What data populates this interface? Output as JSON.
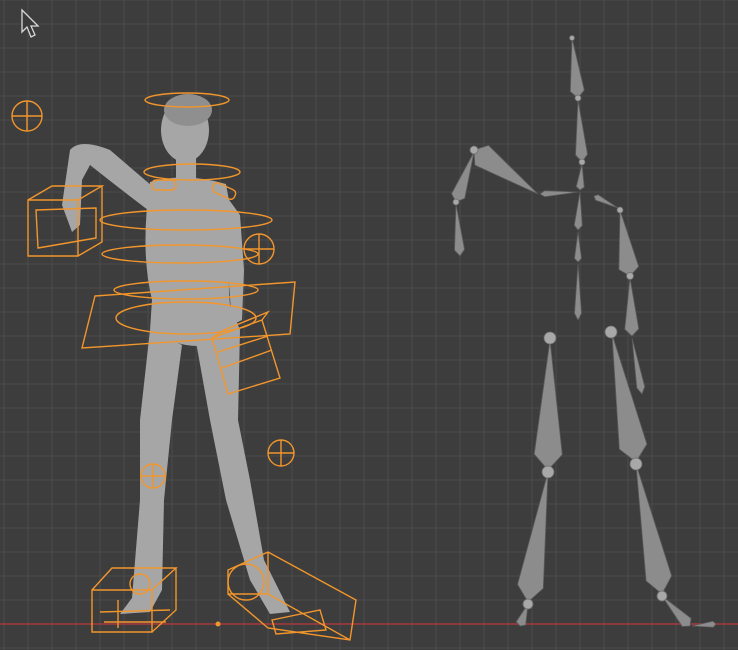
{
  "scene": {
    "viewport": "3d-viewport",
    "objects": [
      "character-mesh",
      "control-rig",
      "armature-bones"
    ]
  },
  "colors": {
    "background": "#3d3d3d",
    "grid": "#4a4a4a",
    "x_axis": "#a63a3f",
    "controls": "#f2962c",
    "mesh": "#a6a6a6",
    "bones": "#8c8c8c"
  },
  "icons": {
    "cursor": "mouse-pointer-icon"
  }
}
